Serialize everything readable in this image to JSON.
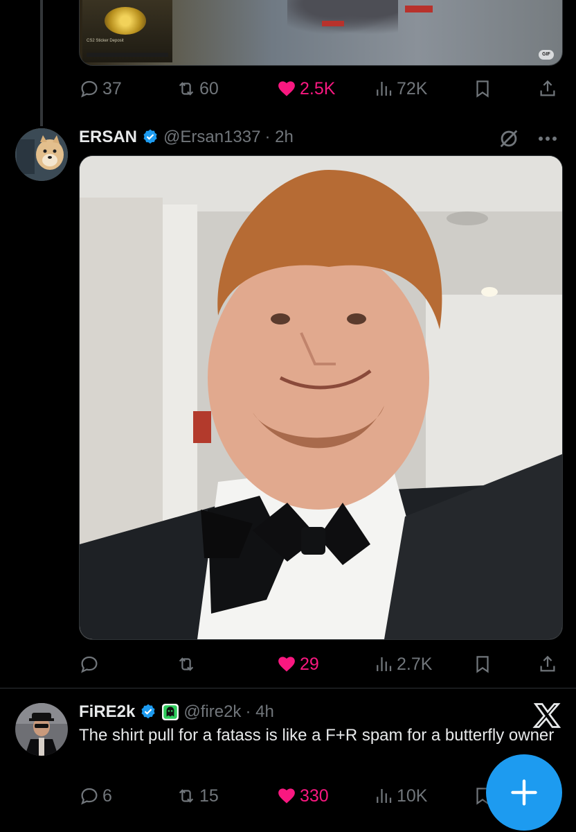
{
  "colors": {
    "background": "#000000",
    "text": "#e7e9ea",
    "muted": "#71767b",
    "like": "#f91880",
    "accent": "#1d9bf0",
    "verified": "#1d9bf0"
  },
  "tweet_prev": {
    "media": {
      "caption": "CS2 Sticker Deposit"
    },
    "actions": {
      "replies": "37",
      "reposts": "60",
      "likes": "2.5K",
      "views": "72K"
    }
  },
  "tweet_ersan": {
    "author": {
      "name": "ERSAN",
      "handle": "@Ersan1337",
      "time": "· 2h",
      "verified": true
    },
    "actions": {
      "replies": "",
      "reposts": "",
      "likes": "29",
      "views": "2.7K"
    }
  },
  "tweet_fire": {
    "author": {
      "name": "FiRE2k",
      "handle": "@fire2k",
      "time": "· 4h",
      "verified": true
    },
    "text": "The shirt pull for a fatass is like a F+R spam for a butterfly owner",
    "actions": {
      "replies": "6",
      "reposts": "15",
      "likes": "330",
      "views": "10K"
    }
  },
  "icons": [
    "reply-icon",
    "repost-icon",
    "like-icon",
    "views-icon",
    "bookmark-icon",
    "share-icon",
    "grok-icon",
    "more-icon",
    "x-logo-icon",
    "compose-icon"
  ]
}
